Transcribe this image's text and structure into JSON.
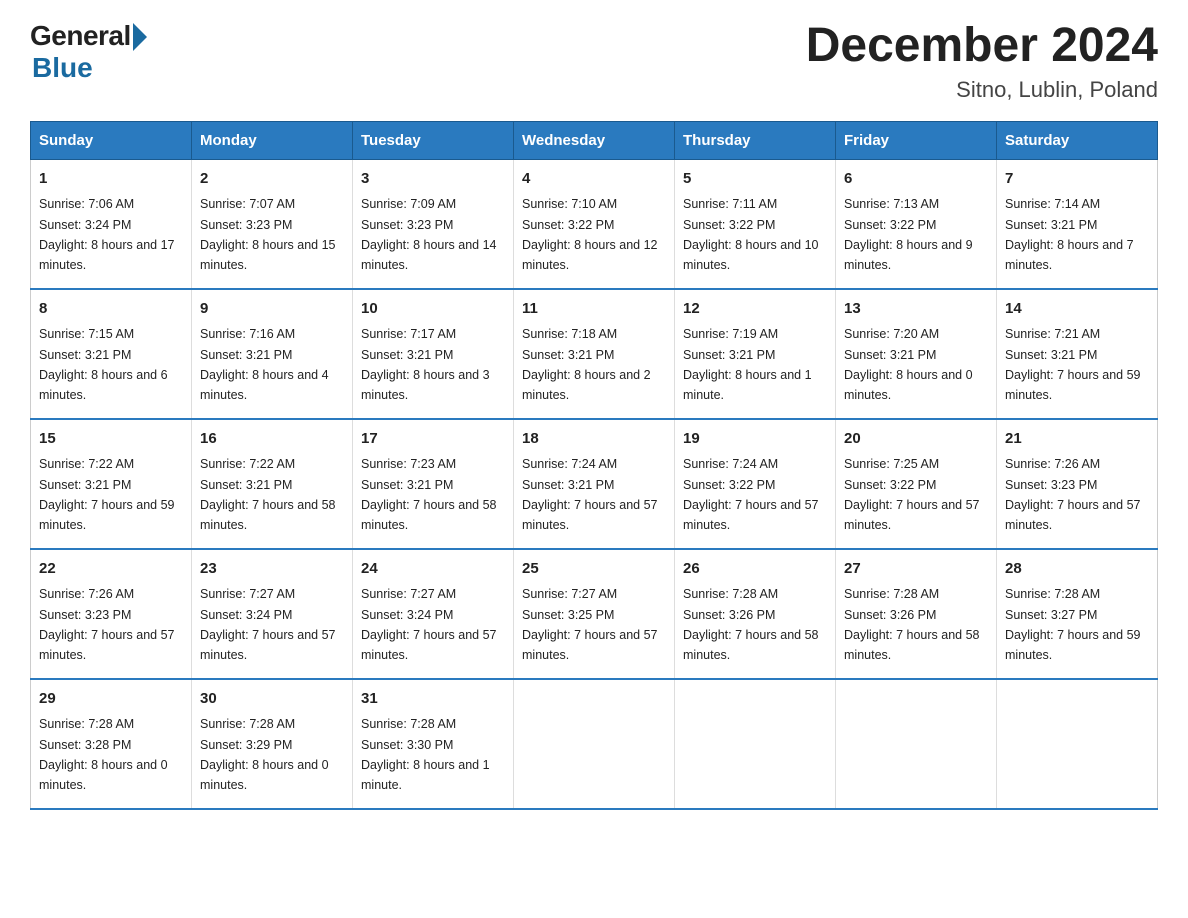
{
  "header": {
    "logo_general": "General",
    "logo_blue": "Blue",
    "title": "December 2024",
    "subtitle": "Sitno, Lublin, Poland"
  },
  "days_of_week": [
    "Sunday",
    "Monday",
    "Tuesday",
    "Wednesday",
    "Thursday",
    "Friday",
    "Saturday"
  ],
  "weeks": [
    [
      {
        "day": "1",
        "sunrise": "7:06 AM",
        "sunset": "3:24 PM",
        "daylight": "8 hours and 17 minutes."
      },
      {
        "day": "2",
        "sunrise": "7:07 AM",
        "sunset": "3:23 PM",
        "daylight": "8 hours and 15 minutes."
      },
      {
        "day": "3",
        "sunrise": "7:09 AM",
        "sunset": "3:23 PM",
        "daylight": "8 hours and 14 minutes."
      },
      {
        "day": "4",
        "sunrise": "7:10 AM",
        "sunset": "3:22 PM",
        "daylight": "8 hours and 12 minutes."
      },
      {
        "day": "5",
        "sunrise": "7:11 AM",
        "sunset": "3:22 PM",
        "daylight": "8 hours and 10 minutes."
      },
      {
        "day": "6",
        "sunrise": "7:13 AM",
        "sunset": "3:22 PM",
        "daylight": "8 hours and 9 minutes."
      },
      {
        "day": "7",
        "sunrise": "7:14 AM",
        "sunset": "3:21 PM",
        "daylight": "8 hours and 7 minutes."
      }
    ],
    [
      {
        "day": "8",
        "sunrise": "7:15 AM",
        "sunset": "3:21 PM",
        "daylight": "8 hours and 6 minutes."
      },
      {
        "day": "9",
        "sunrise": "7:16 AM",
        "sunset": "3:21 PM",
        "daylight": "8 hours and 4 minutes."
      },
      {
        "day": "10",
        "sunrise": "7:17 AM",
        "sunset": "3:21 PM",
        "daylight": "8 hours and 3 minutes."
      },
      {
        "day": "11",
        "sunrise": "7:18 AM",
        "sunset": "3:21 PM",
        "daylight": "8 hours and 2 minutes."
      },
      {
        "day": "12",
        "sunrise": "7:19 AM",
        "sunset": "3:21 PM",
        "daylight": "8 hours and 1 minute."
      },
      {
        "day": "13",
        "sunrise": "7:20 AM",
        "sunset": "3:21 PM",
        "daylight": "8 hours and 0 minutes."
      },
      {
        "day": "14",
        "sunrise": "7:21 AM",
        "sunset": "3:21 PM",
        "daylight": "7 hours and 59 minutes."
      }
    ],
    [
      {
        "day": "15",
        "sunrise": "7:22 AM",
        "sunset": "3:21 PM",
        "daylight": "7 hours and 59 minutes."
      },
      {
        "day": "16",
        "sunrise": "7:22 AM",
        "sunset": "3:21 PM",
        "daylight": "7 hours and 58 minutes."
      },
      {
        "day": "17",
        "sunrise": "7:23 AM",
        "sunset": "3:21 PM",
        "daylight": "7 hours and 58 minutes."
      },
      {
        "day": "18",
        "sunrise": "7:24 AM",
        "sunset": "3:21 PM",
        "daylight": "7 hours and 57 minutes."
      },
      {
        "day": "19",
        "sunrise": "7:24 AM",
        "sunset": "3:22 PM",
        "daylight": "7 hours and 57 minutes."
      },
      {
        "day": "20",
        "sunrise": "7:25 AM",
        "sunset": "3:22 PM",
        "daylight": "7 hours and 57 minutes."
      },
      {
        "day": "21",
        "sunrise": "7:26 AM",
        "sunset": "3:23 PM",
        "daylight": "7 hours and 57 minutes."
      }
    ],
    [
      {
        "day": "22",
        "sunrise": "7:26 AM",
        "sunset": "3:23 PM",
        "daylight": "7 hours and 57 minutes."
      },
      {
        "day": "23",
        "sunrise": "7:27 AM",
        "sunset": "3:24 PM",
        "daylight": "7 hours and 57 minutes."
      },
      {
        "day": "24",
        "sunrise": "7:27 AM",
        "sunset": "3:24 PM",
        "daylight": "7 hours and 57 minutes."
      },
      {
        "day": "25",
        "sunrise": "7:27 AM",
        "sunset": "3:25 PM",
        "daylight": "7 hours and 57 minutes."
      },
      {
        "day": "26",
        "sunrise": "7:28 AM",
        "sunset": "3:26 PM",
        "daylight": "7 hours and 58 minutes."
      },
      {
        "day": "27",
        "sunrise": "7:28 AM",
        "sunset": "3:26 PM",
        "daylight": "7 hours and 58 minutes."
      },
      {
        "day": "28",
        "sunrise": "7:28 AM",
        "sunset": "3:27 PM",
        "daylight": "7 hours and 59 minutes."
      }
    ],
    [
      {
        "day": "29",
        "sunrise": "7:28 AM",
        "sunset": "3:28 PM",
        "daylight": "8 hours and 0 minutes."
      },
      {
        "day": "30",
        "sunrise": "7:28 AM",
        "sunset": "3:29 PM",
        "daylight": "8 hours and 0 minutes."
      },
      {
        "day": "31",
        "sunrise": "7:28 AM",
        "sunset": "3:30 PM",
        "daylight": "8 hours and 1 minute."
      },
      null,
      null,
      null,
      null
    ]
  ]
}
